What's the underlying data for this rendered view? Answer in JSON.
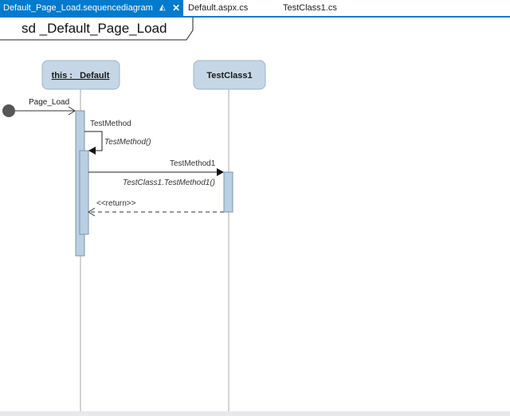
{
  "tabs": [
    {
      "label": "Default_Page_Load.sequencediagram",
      "active": true
    },
    {
      "label": "Default.aspx.cs",
      "active": false
    },
    {
      "label": "TestClass1.cs",
      "active": false
    }
  ],
  "icons": {
    "pin": "pin-icon",
    "close": "close-icon"
  },
  "diagram": {
    "frame_title": "sd _Default_Page_Load",
    "lifelines": [
      {
        "name": "this : _Default"
      },
      {
        "name": "TestClass1"
      }
    ],
    "messages": {
      "page_load": "Page_Load",
      "test_method": "TestMethod",
      "test_method_call": "TestMethod()",
      "test_method1": "TestMethod1",
      "test_method1_call": "TestClass1.TestMethod1()",
      "return": "<<return>>"
    }
  },
  "colors": {
    "accent": "#007acc",
    "lifeline_head": "#c5d6e6",
    "activation": "#b9cfe2",
    "border": "#7b96b3"
  }
}
